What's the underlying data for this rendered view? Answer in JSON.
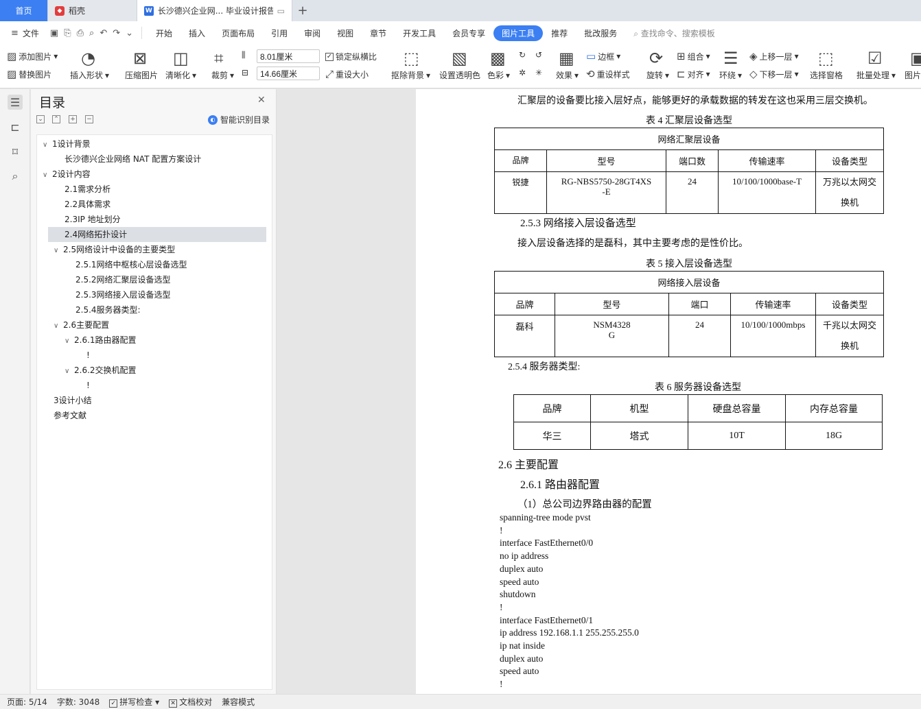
{
  "tabs": {
    "home": "首页",
    "daoke": "稻壳",
    "doc": "长沙德兴企业网... 毕业设计报告",
    "plus": "+"
  },
  "menu": {
    "file": "文件",
    "items": [
      "开始",
      "插入",
      "页面布局",
      "引用",
      "审阅",
      "视图",
      "章节",
      "开发工具",
      "会员专享"
    ],
    "active": "图片工具",
    "after": [
      "推荐",
      "批改服务"
    ],
    "search": "查找命令、搜索模板"
  },
  "ribbon": {
    "add_image": "添加图片",
    "replace_image": "替换图片",
    "insert_shape": "插入形状",
    "compress": "压缩图片",
    "sharpen": "清晰化",
    "crop": "裁剪",
    "width": "8.01厘米",
    "height": "14.66厘米",
    "lock_ratio": "锁定纵横比",
    "reset_size": "重设大小",
    "remove_bg": "抠除背景",
    "set_transparent": "设置透明色",
    "color": "色彩",
    "effect": "效果",
    "border": "边框",
    "reset_style": "重设样式",
    "rotate": "旋转",
    "group": "组合",
    "align": "对齐",
    "wrap": "环绕",
    "bring_forward": "上移一层",
    "send_backward": "下移一层",
    "select_pane": "选择窗格",
    "batch": "批量处理",
    "image": "图片"
  },
  "toc": {
    "title": "目录",
    "smart": "智能识别目录",
    "items": [
      {
        "text": "1设计背景",
        "level": 0,
        "toggle": "∨"
      },
      {
        "text": "长沙德兴企业网络 NAT 配置方案设计",
        "level": 1
      },
      {
        "text": "2设计内容",
        "level": 0,
        "toggle": "∨"
      },
      {
        "text": "2.1需求分析",
        "level": 1
      },
      {
        "text": "2.2具体需求",
        "level": 1
      },
      {
        "text": "2.3IP 地址划分",
        "level": 1
      },
      {
        "text": "2.4网络拓扑设计",
        "level": 1,
        "selected": true
      },
      {
        "text": "2.5网络设计中设备的主要类型",
        "level": 1,
        "toggle": "∨"
      },
      {
        "text": "2.5.1网络中枢核心层设备选型",
        "level": 2
      },
      {
        "text": "2.5.2网络汇聚层设备选型",
        "level": 2
      },
      {
        "text": "2.5.3网络接入层设备选型",
        "level": 2
      },
      {
        "text": "2.5.4服务器类型:",
        "level": 2
      },
      {
        "text": "2.6主要配置",
        "level": 1,
        "toggle": "∨"
      },
      {
        "text": "2.6.1路由器配置",
        "level": 2,
        "toggle": "∨"
      },
      {
        "text": "!",
        "level": 3
      },
      {
        "text": "2.6.2交换机配置",
        "level": 2,
        "toggle": "∨"
      },
      {
        "text": "!",
        "level": 3
      },
      {
        "text": "3设计小结",
        "level": 0
      },
      {
        "text": "参考文献",
        "level": 0
      }
    ]
  },
  "doc": {
    "line1": "汇聚层的设备要比接入层好点，能够更好的承载数据的转发在这也采用三层交换机。",
    "cap4": "表 4 汇聚层设备选型",
    "t4": {
      "header": "网络汇聚层设备",
      "cols": [
        "品牌",
        "型号",
        "端口数",
        "传输速率",
        "设备类型"
      ],
      "row": [
        "锐捷",
        "RG-NBS5750-28GT4XS-E",
        "24",
        "10/100/1000base-T",
        "万兆以太网交换机"
      ]
    },
    "h253": "2.5.3 网络接入层设备选型",
    "line2": "接入层设备选择的是磊科，其中主要考虑的是性价比。",
    "cap5": "表 5 接入层设备选型",
    "t5": {
      "header": "网络接入层设备",
      "cols": [
        "品牌",
        "型号",
        "端口",
        "传输速率",
        "设备类型"
      ],
      "row": [
        "磊科",
        "NSM4328G",
        "24",
        "10/100/1000mbps",
        "千兆以太网交换机"
      ]
    },
    "h254": "2.5.4 服务器类型:",
    "cap6": "表 6 服务器设备选型",
    "t6": {
      "cols": [
        "品牌",
        "机型",
        "硬盘总容量",
        "内存总容量"
      ],
      "row": [
        "华三",
        "塔式",
        "10T",
        "18G"
      ]
    },
    "h26": "2.6 主要配置",
    "h261": "2.6.1 路由器配置",
    "sub1": "（1）总公司边界路由器的配置",
    "code": [
      "spanning-tree mode pvst",
      "!",
      "interface FastEthernet0/0",
      "no ip address",
      "duplex auto",
      "speed auto",
      "shutdown",
      "!",
      "interface FastEthernet0/1",
      "ip address 192.168.1.1 255.255.255.0",
      "ip nat inside",
      "duplex auto",
      "speed auto",
      "!"
    ]
  },
  "status": {
    "page": "页面: 5/14",
    "words": "字数: 3048",
    "spell": "拼写检查",
    "proof": "文档校对",
    "compat": "兼容模式"
  }
}
